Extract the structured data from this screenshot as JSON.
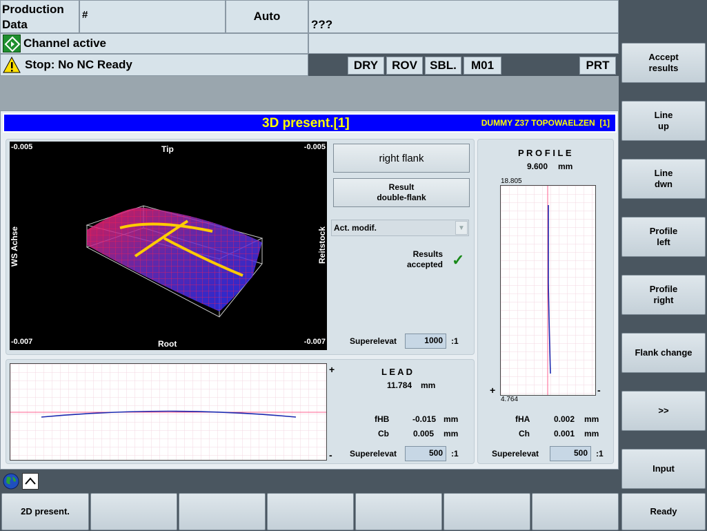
{
  "header": {
    "area": "Production\nData",
    "program": "#",
    "mode": "Auto",
    "prog_name": "???",
    "channel_status": "Channel active",
    "alarm": "Stop: No NC Ready",
    "states": [
      "DRY",
      "ROV",
      "SBL.",
      "M01"
    ],
    "prt": "PRT"
  },
  "title_bar": {
    "title": "3D present.[1]",
    "subtitle": "DUMMY Z37 TOPOWAELZEN  [1]"
  },
  "view3d": {
    "top_left": "-0.005",
    "top_right": "-0.005",
    "bottom_left": "-0.007",
    "bottom_right": "-0.007",
    "top": "Tip",
    "bottom": "Root",
    "left": "WS Achse",
    "right": "Reitstock"
  },
  "controls": {
    "flank_btn": "right flank",
    "result_btn": "Result\ndouble-flank",
    "modif_select": "Act. modif.",
    "results_accepted": "Results\naccepted",
    "superelevat_label": "Superelevat",
    "superelevat_value": "1000",
    "superelevat_ratio": ":1"
  },
  "lead": {
    "title": "L E A D",
    "value": "11.784",
    "unit": "mm",
    "fHB_label": "fHB",
    "fHB_value": "-0.015",
    "Cb_label": "Cb",
    "Cb_value": "0.005",
    "superelevat_label": "Superelevat",
    "superelevat_value": "500",
    "superelevat_ratio": ":1",
    "plus": "+",
    "minus": "-"
  },
  "profile": {
    "title": "P R O F I L E",
    "value": "9.600",
    "unit": "mm",
    "y_top": "18.805",
    "y_bottom": "4.764",
    "fHA_label": "fHA",
    "fHA_value": "0.002",
    "Ch_label": "Ch",
    "Ch_value": "0.001",
    "superelevat_label": "Superelevat",
    "superelevat_value": "500",
    "superelevat_ratio": ":1",
    "plus": "+",
    "minus": "-"
  },
  "vsoftkeys": [
    "Accept\nresults",
    "Line\nup",
    "Line\ndwn",
    "Profile\nleft",
    "Profile\nright",
    "Flank change",
    ">>",
    "Input"
  ],
  "hsoftkeys": [
    "2D present.",
    "",
    "",
    "",
    "",
    "",
    ""
  ],
  "ready_key": "Ready",
  "colors": {
    "title_bar": "#0000ff",
    "title_text": "#ffff00",
    "accent_line": "#ffcc00"
  }
}
